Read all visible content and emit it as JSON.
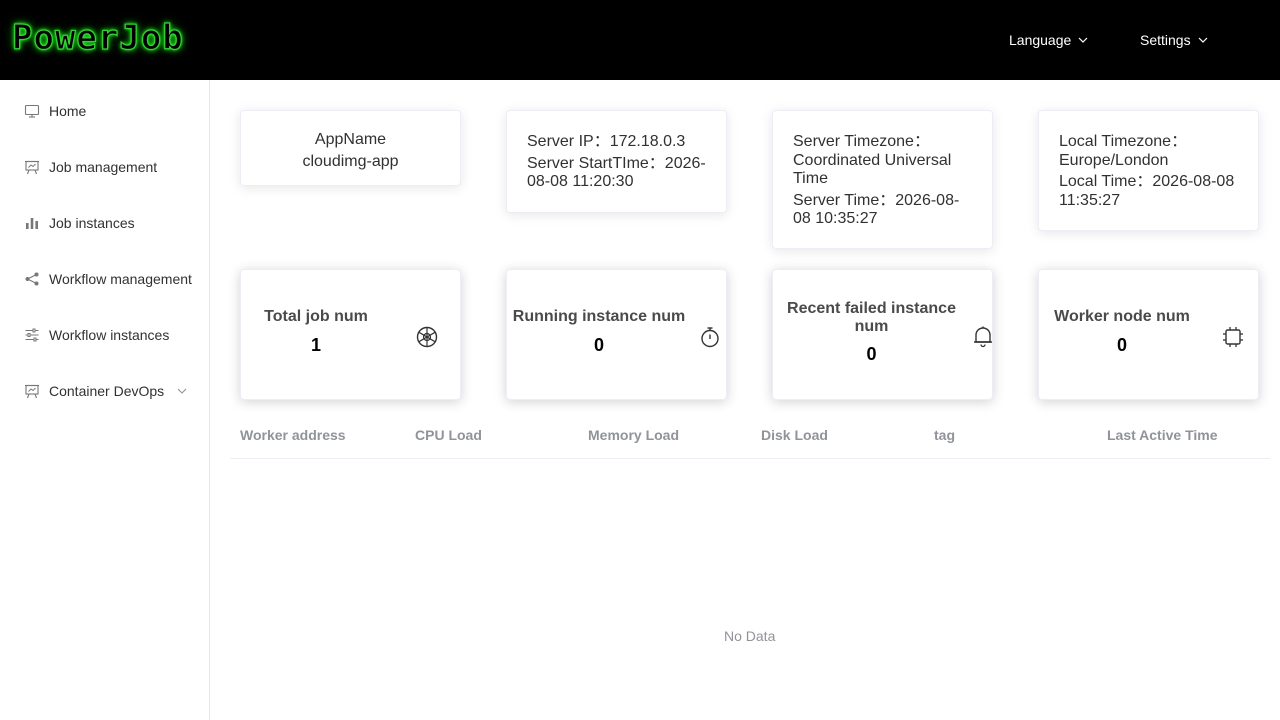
{
  "header": {
    "logo": "PowerJob",
    "language": "Language",
    "settings": "Settings"
  },
  "sidebar": {
    "items": [
      {
        "label": "Home",
        "icon": "monitor-icon"
      },
      {
        "label": "Job management",
        "icon": "presentation-icon"
      },
      {
        "label": "Job instances",
        "icon": "bar-chart-icon"
      },
      {
        "label": "Workflow management",
        "icon": "share-icon"
      },
      {
        "label": "Workflow instances",
        "icon": "sliders-icon"
      },
      {
        "label": "Container DevOps",
        "icon": "presentation-icon"
      }
    ]
  },
  "info": {
    "app_name_label": "AppName",
    "app_name": "cloudimg-app",
    "server_ip": "Server IP：172.18.0.3",
    "server_start_l1": "Server StartTIme：2026-",
    "server_start_l2": "08-08 11:20:30",
    "server_tz_l1": "Server Timezone：",
    "server_tz_l2": "Coordinated Universal",
    "server_tz_l3": "Time",
    "server_time_l1": "Server Time：2026-08-",
    "server_time_l2": "08 10:35:27",
    "local_tz_l1": "Local Timezone：",
    "local_tz_l2": "Europe/London",
    "local_time_l1": "Local Time：2026-08-08",
    "local_time_l2": "11:35:27"
  },
  "stats": {
    "total_job_label": "Total job num",
    "total_job_value": "1",
    "running_label": "Running instance num",
    "running_value": "0",
    "failed_label_l1": "Recent failed instance",
    "failed_label_l2": "num",
    "failed_value": "0",
    "worker_label": "Worker node num",
    "worker_value": "0"
  },
  "table": {
    "columns": [
      "Worker address",
      "CPU Load",
      "Memory Load",
      "Disk Load",
      "tag",
      "Last Active Time"
    ],
    "empty_text": "No Data"
  },
  "colors": {
    "header_bg": "#000000",
    "logo_glow": "#1eff1e"
  }
}
